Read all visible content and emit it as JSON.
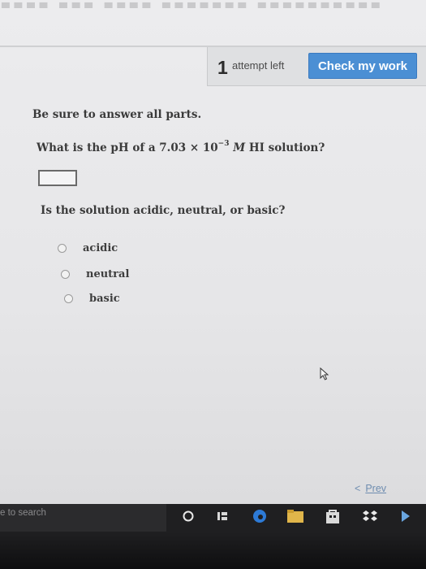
{
  "header": {
    "attempt_count": "1",
    "attempt_label": "attempt left",
    "check_button": "Check my work"
  },
  "question": {
    "instructions": "Be sure to answer all parts.",
    "part1_prefix": "What is the pH of a 7.03 × 10",
    "part1_exponent": "−3",
    "part1_unit": "M",
    "part1_suffix": " HI solution?",
    "answer_value": "",
    "part2": "Is the solution acidic, neutral, or basic?",
    "options": [
      "acidic",
      "neutral",
      "basic"
    ]
  },
  "navigation": {
    "prev_label": "Prev"
  },
  "taskbar": {
    "search_text": "e to search",
    "icons": [
      "cortana-icon",
      "task-view-icon",
      "edge-icon",
      "file-explorer-icon",
      "store-icon",
      "dropbox-icon",
      "app-icon"
    ]
  }
}
